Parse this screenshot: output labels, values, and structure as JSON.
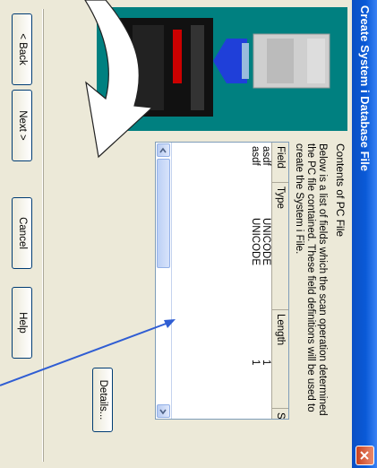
{
  "window": {
    "title": "Create System i Database File"
  },
  "content": {
    "heading": "Contents of PC File",
    "description": "Below is a list of fields which the scan operation determined the PC file contained.  These field definitions will be used to create the System i File."
  },
  "table": {
    "columns": [
      "Field",
      "Type",
      "Length",
      "S"
    ],
    "rows": [
      {
        "field": "asdf",
        "type": "UNICODE",
        "length": "1"
      },
      {
        "field": "asdf",
        "type": "UNICODE",
        "length": "1"
      }
    ]
  },
  "buttons": {
    "details": "Details...",
    "back": "< Back",
    "next": "Next >",
    "cancel": "Cancel",
    "help": "Help"
  },
  "colors": {
    "title_bar": "#0a5ad7",
    "picture_bg": "#008080",
    "callout_arrow": "#2f5dd3"
  }
}
